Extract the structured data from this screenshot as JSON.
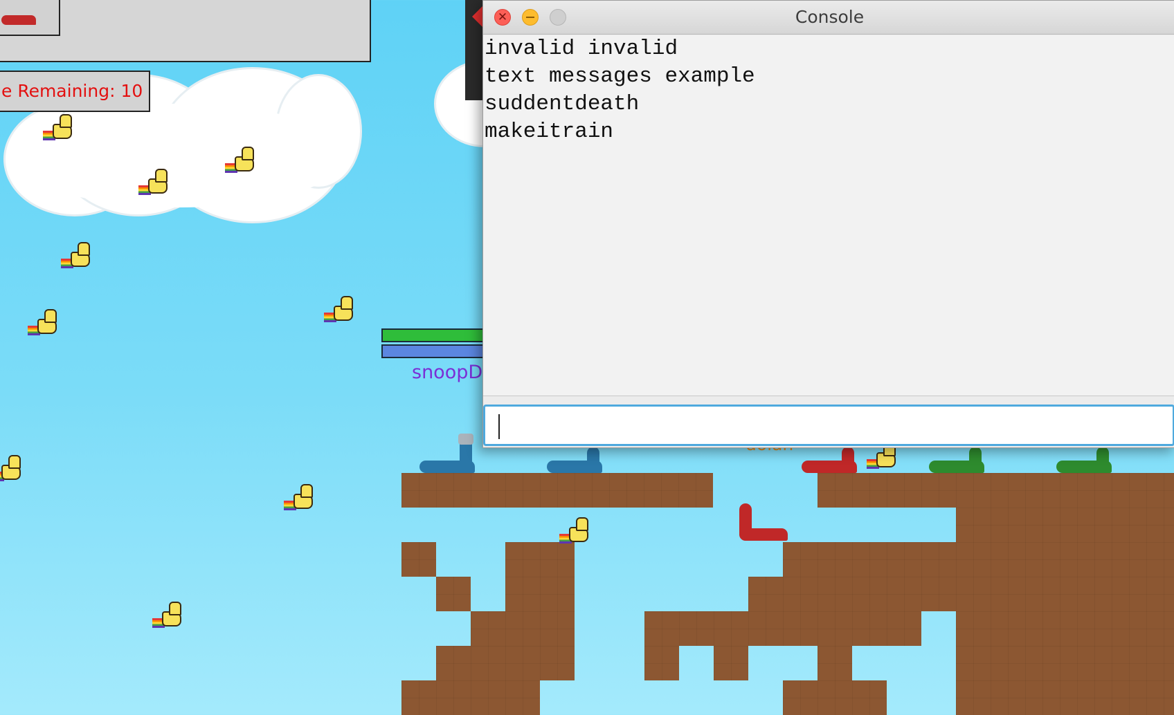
{
  "hud": {
    "time_remaining": "e Remaining: 10"
  },
  "players": {
    "self_name": "snoopD",
    "other_name": "dolan"
  },
  "console": {
    "title": "Console",
    "lines": [
      "invalid invalid",
      "text messages example",
      "suddentdeath",
      "makeitrain"
    ],
    "input_value": "",
    "buttons": {
      "close": "close",
      "minimize": "minimize",
      "zoom": "zoom"
    }
  },
  "colors": {
    "time_text": "#e31010",
    "health_bar": "#2fbd3a",
    "shield_bar": "#5b86e0",
    "dirt": "#8c5732",
    "sky": "#6fd8f7"
  },
  "icons": {
    "duck": "rainbow-duck-icon",
    "worm": "worm-icon"
  }
}
